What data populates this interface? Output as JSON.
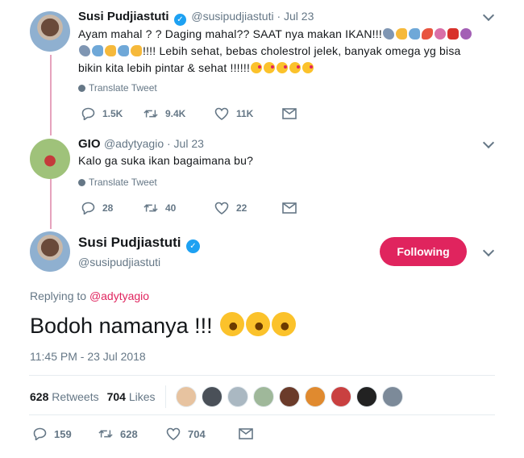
{
  "tweet1": {
    "name": "Susi Pudjiastuti",
    "handle": "@susipudjiastuti · Jul 23",
    "line1": "Ayam mahal ? ? Daging mahal??  SAAT nya makan IKAN!!!",
    "line2": "!!!! Lebih sehat, bebas cholestrol jelek, banyak omega yg bisa",
    "line3": "bikin kita lebih pintar & sehat !!!!!!",
    "translate": "Translate Tweet",
    "replies": "1.5K",
    "retweets": "9.4K",
    "likes": "11K"
  },
  "tweet2": {
    "name": "GIO",
    "handle": "@adytyagio · Jul 23",
    "text": "Kalo ga suka ikan bagaimana bu?",
    "translate": "Translate Tweet",
    "replies": "28",
    "retweets": "40",
    "likes": "22"
  },
  "main": {
    "name": "Susi Pudjiastuti",
    "handle": "@susipudjiastuti",
    "follow_label": "Following",
    "replying_prefix": "Replying to ",
    "replying_handle": "@adytyagio",
    "text": "Bodoh namanya !!! ",
    "timestamp": "11:45 PM - 23 Jul 2018",
    "retweets_count": "628",
    "retweets_label": " Retweets",
    "likes_count": "704",
    "likes_label": " Likes",
    "replies": "159",
    "retweets": "628",
    "likes": "704"
  },
  "colors": {
    "accent": "#1da1f2",
    "following": "#e0245e",
    "thread_line": "#e6a3bd",
    "muted": "#657786"
  }
}
